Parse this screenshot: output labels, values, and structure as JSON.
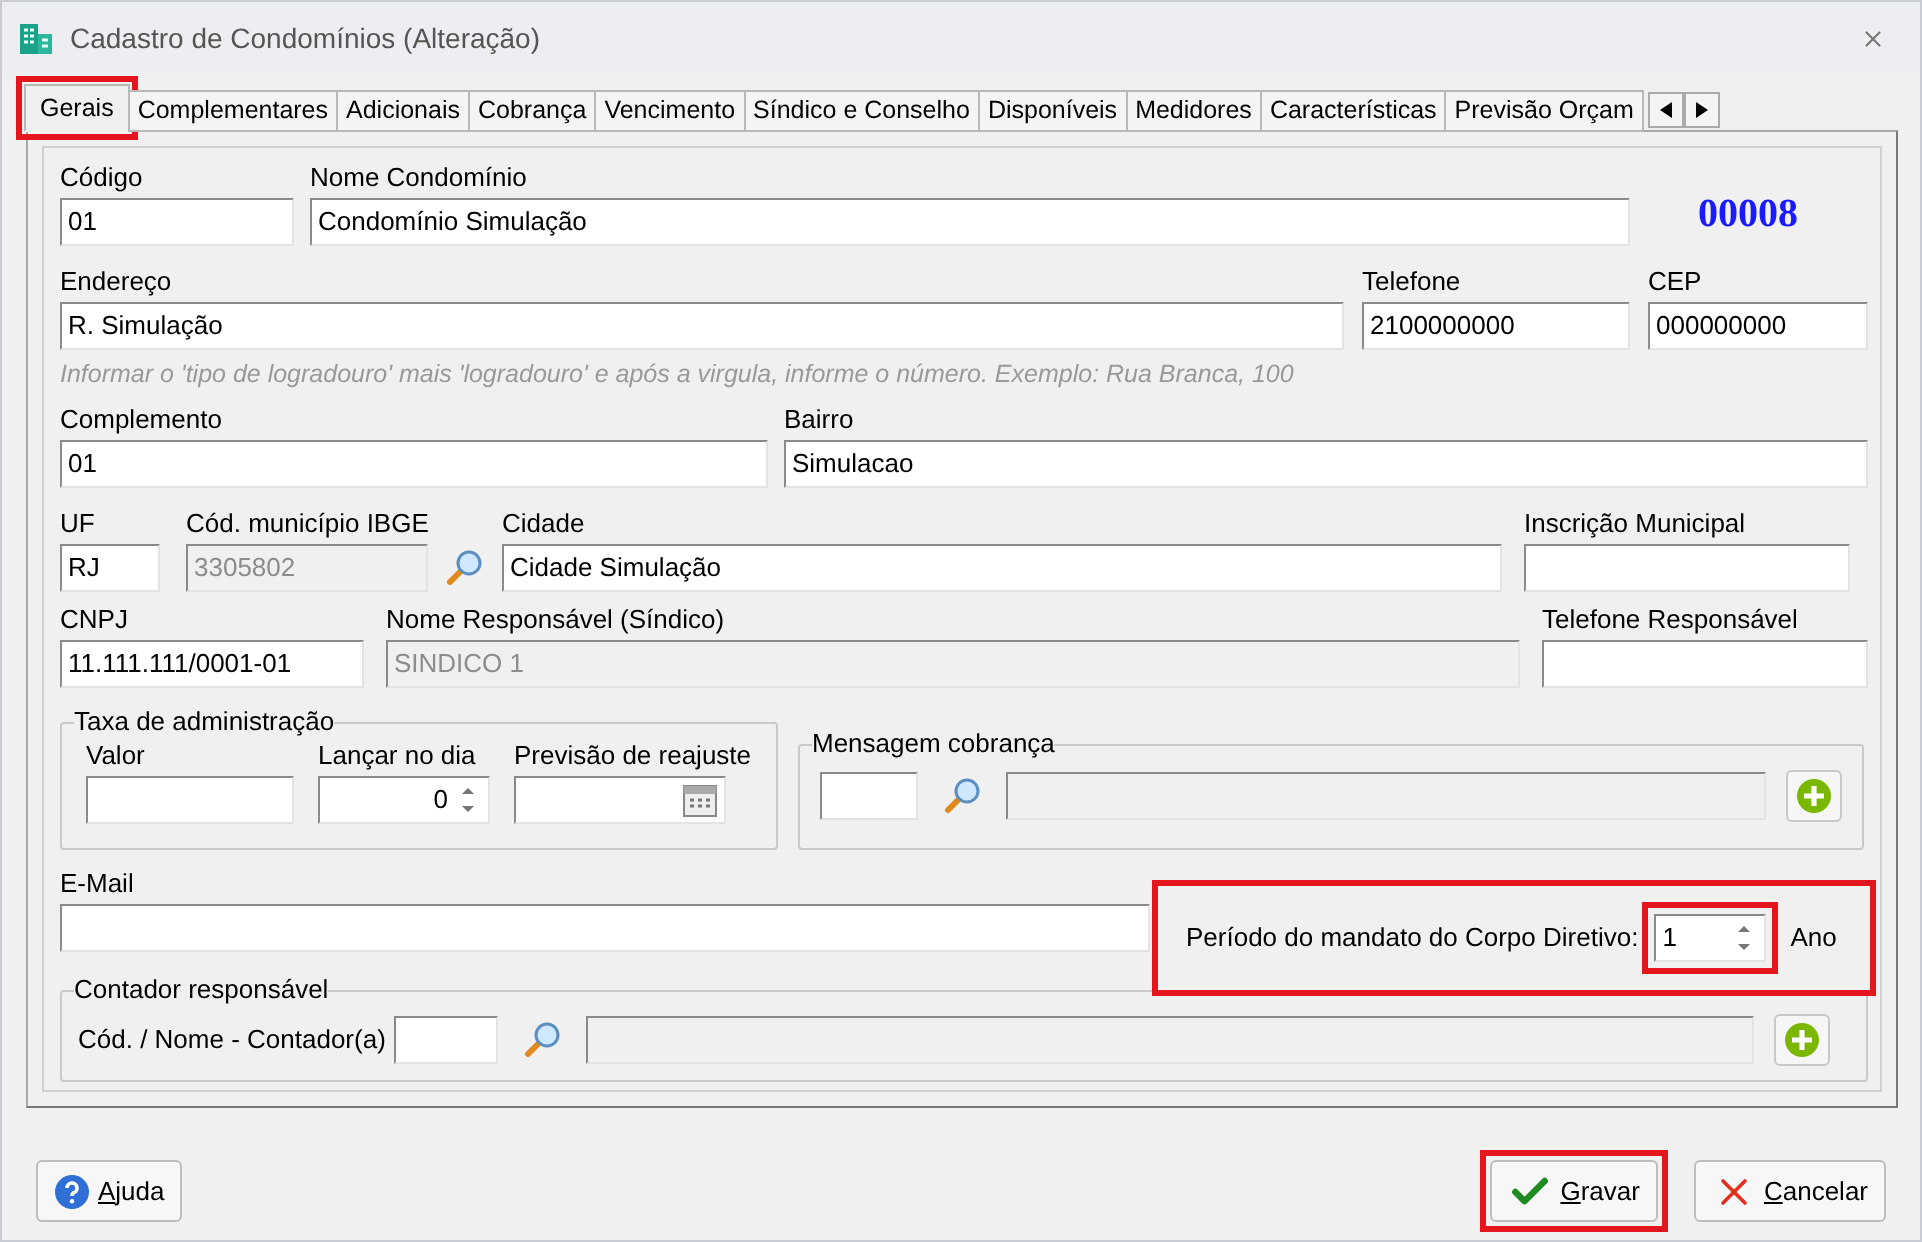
{
  "window": {
    "title": "Cadastro de Condomínios (Alteração)"
  },
  "tabs": [
    {
      "label": "Gerais",
      "selected": true,
      "highlighted": true
    },
    {
      "label": "Complementares",
      "selected": false,
      "highlighted": false
    },
    {
      "label": "Adicionais",
      "selected": false,
      "highlighted": false
    },
    {
      "label": "Cobrança",
      "selected": false,
      "highlighted": false
    },
    {
      "label": "Vencimento",
      "selected": false,
      "highlighted": false
    },
    {
      "label": "Síndico e Conselho",
      "selected": false,
      "highlighted": false
    },
    {
      "label": "Disponíveis",
      "selected": false,
      "highlighted": false
    },
    {
      "label": "Medidores",
      "selected": false,
      "highlighted": false
    },
    {
      "label": "Características",
      "selected": false,
      "highlighted": false
    },
    {
      "label": "Previsão Orçam",
      "selected": false,
      "highlighted": false
    }
  ],
  "record_number": "00008",
  "rows": [
    [
      {
        "label": "Código",
        "value": "01",
        "kind": "text",
        "disabled": false
      },
      {
        "label": "Nome Condomínio",
        "value": "Condomínio Simulação",
        "kind": "text",
        "disabled": false
      }
    ],
    [
      {
        "label": "Endereço",
        "value": "R. Simulação",
        "kind": "text",
        "disabled": false
      },
      {
        "label": "Telefone",
        "value": "2100000000",
        "kind": "text",
        "disabled": false
      },
      {
        "label": "CEP",
        "value": "000000000",
        "kind": "text",
        "disabled": false
      }
    ],
    [
      {
        "label": "Complemento",
        "value": "01",
        "kind": "text",
        "disabled": false
      },
      {
        "label": "Bairro",
        "value": "Simulacao",
        "kind": "text",
        "disabled": false
      }
    ],
    [
      {
        "label": "UF",
        "value": "RJ",
        "kind": "text",
        "disabled": false
      },
      {
        "label": "Cód. município IBGE",
        "value": "3305802",
        "kind": "lookup",
        "disabled": true
      },
      {
        "label": "Cidade",
        "value": "Cidade Simulação",
        "kind": "text",
        "disabled": false
      },
      {
        "label": "Inscrição Municipal",
        "kind": "text",
        "disabled": false
      }
    ],
    [
      {
        "label": "CNPJ",
        "value": "11.111.111/0001-01",
        "kind": "text",
        "disabled": false
      },
      {
        "label": "Nome Responsável (Síndico)",
        "value": "SINDICO 1",
        "kind": "text",
        "disabled": true
      },
      {
        "label": "Telefone Responsável",
        "kind": "text",
        "disabled": false
      }
    ]
  ],
  "address_hint": "Informar o 'tipo de logradouro' mais 'logradouro' e após a virgula, informe o número. Exemplo: Rua Branca, 100",
  "taxa_administracao": {
    "title": "Taxa de administração",
    "fields": [
      {
        "label": "Valor",
        "kind": "text"
      },
      {
        "label": "Lançar no dia",
        "kind": "spin",
        "value": "0"
      },
      {
        "label": "Previsão de reajuste",
        "kind": "date"
      }
    ]
  },
  "mensagem_cobranca": {
    "title": "Mensagem cobrança"
  },
  "email": {
    "label": "E-Mail"
  },
  "mandato": {
    "label": "Período do mandato do Corpo Diretivo:",
    "value": "1",
    "unit": "Ano",
    "highlighted": true,
    "field_highlighted": true
  },
  "contador": {
    "title": "Contador responsável",
    "label": "Cód. / Nome - Contador(a)"
  },
  "buttons": [
    {
      "label": "Ajuda",
      "kind": "help",
      "highlighted": false
    },
    {
      "label": "Gravar",
      "kind": "save",
      "highlighted": true
    },
    {
      "label": "Cancelar",
      "kind": "cancel",
      "highlighted": false
    }
  ]
}
